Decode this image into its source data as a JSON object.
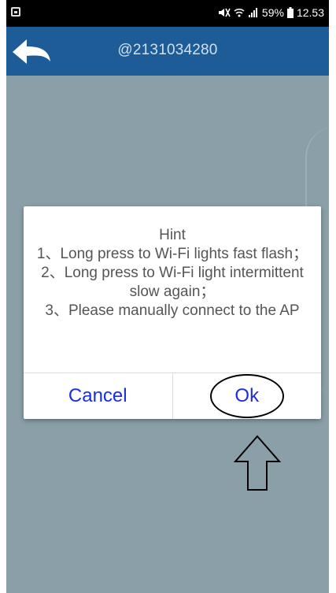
{
  "status_bar": {
    "battery": "59%",
    "time": "12.53",
    "icons": [
      "screenshot-icon",
      "mute-icon",
      "wifi-icon",
      "signal-icon",
      "battery-icon"
    ]
  },
  "header": {
    "title": "@2131034280",
    "back_icon": "back-arrow-icon"
  },
  "dialog": {
    "title": "Hint",
    "lines": [
      "1、Long press to Wi-Fi lights fast flash；",
      "2、Long press to Wi-Fi light intermittent slow again；",
      "3、Please manually connect to the AP"
    ],
    "cancel_label": "Cancel",
    "ok_label": "Ok"
  },
  "colors": {
    "header": "#1e5c98",
    "overlay": "#8a9fa8",
    "button_text": "#1a2ee0"
  }
}
